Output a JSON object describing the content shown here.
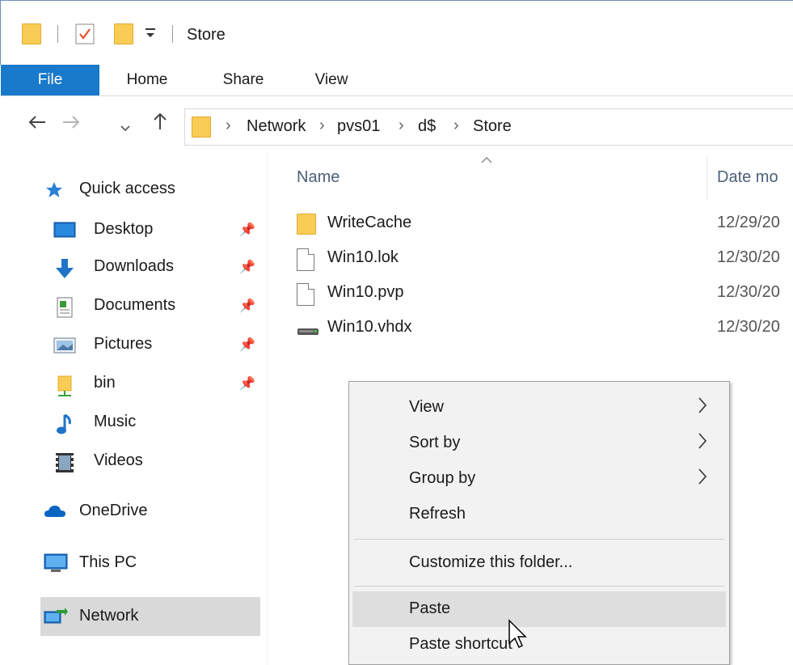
{
  "window": {
    "title": "Store",
    "quick_access_toolbar": [
      "folder-icon",
      "properties-icon",
      "new-folder-icon",
      "customize-dropdown-icon"
    ]
  },
  "ribbon": {
    "tabs": [
      {
        "label": "File"
      },
      {
        "label": "Home"
      },
      {
        "label": "Share"
      },
      {
        "label": "View"
      }
    ]
  },
  "address": {
    "back_icon": "back-arrow-icon",
    "forward_icon": "forward-arrow-icon",
    "recent_icon": "chevron-down-icon",
    "up_icon": "up-arrow-icon",
    "breadcrumbs": [
      "Network",
      "pvs01",
      "d$",
      "Store"
    ]
  },
  "nav_pane": {
    "quick_access": "Quick access",
    "pinned": [
      {
        "label": "Desktop",
        "icon": "desktop-icon"
      },
      {
        "label": "Downloads",
        "icon": "download-icon"
      },
      {
        "label": "Documents",
        "icon": "documents-icon"
      },
      {
        "label": "Pictures",
        "icon": "pictures-icon"
      },
      {
        "label": "bin",
        "icon": "network-folder-icon"
      }
    ],
    "unpinned": [
      {
        "label": "Music",
        "icon": "music-icon"
      },
      {
        "label": "Videos",
        "icon": "videos-icon"
      }
    ],
    "onedrive": "OneDrive",
    "this_pc": "This PC",
    "network": "Network"
  },
  "file_list": {
    "columns": {
      "name": "Name",
      "date": "Date mo"
    },
    "files": [
      {
        "name": "WriteCache",
        "date": "12/29/20",
        "type": "folder"
      },
      {
        "name": "Win10.lok",
        "date": "12/30/20",
        "type": "file"
      },
      {
        "name": "Win10.pvp",
        "date": "12/30/20",
        "type": "file"
      },
      {
        "name": "Win10.vhdx",
        "date": "12/30/20",
        "type": "disk"
      }
    ]
  },
  "context_menu": {
    "items": [
      {
        "label": "View",
        "submenu": true
      },
      {
        "label": "Sort by",
        "submenu": true
      },
      {
        "label": "Group by",
        "submenu": true
      },
      {
        "label": "Refresh",
        "submenu": false
      },
      {
        "label": "Customize this folder...",
        "submenu": false
      },
      {
        "label": "Paste",
        "submenu": false,
        "highlighted": true
      },
      {
        "label": "Paste shortcut",
        "submenu": false
      }
    ]
  },
  "colors": {
    "file_tab": "#1979ca",
    "folder": "#f8cc55",
    "selected_nav": "#d9d9d9",
    "menu_bg": "#f2f2f2",
    "menu_hover": "#dedede"
  }
}
